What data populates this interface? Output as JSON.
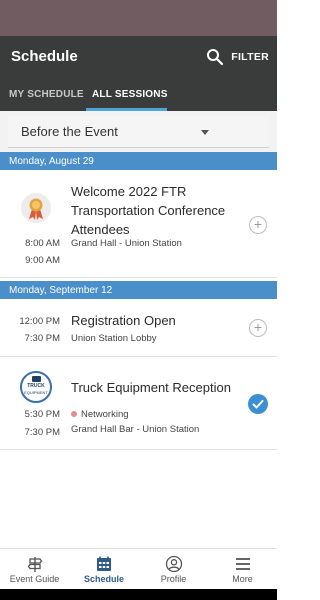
{
  "appbar": {
    "title": "Schedule",
    "filter_label": "FILTER"
  },
  "tabs": [
    {
      "label": "MY SCHEDULE",
      "active": false
    },
    {
      "label": "ALL SESSIONS",
      "active": true
    }
  ],
  "dropdown": {
    "selected": "Before the Event"
  },
  "days": [
    {
      "date": "Monday, August 29"
    },
    {
      "date": "Monday, September 12"
    }
  ],
  "sessions": [
    {
      "title": "Welcome 2022 FTR Transportation Conference Attendees",
      "location": "Grand Hall - Union Station",
      "start": "8:00 AM",
      "end": "9:00 AM",
      "logo": "award-ribbon-icon",
      "added": false
    },
    {
      "title": "Registration Open",
      "location": "Union Station Lobby",
      "start": "12:00 PM",
      "end": "7:30 PM",
      "added": false
    },
    {
      "title": "Truck Equipment Reception",
      "track": "Networking",
      "track_color": "#e98b8b",
      "location": "Grand Hall Bar - Union Station",
      "start": "5:30 PM",
      "end": "7:30 PM",
      "logo": "truck-equipment-logo",
      "logo_text_1": "TRUCK",
      "logo_text_2": "EQUIPMENT",
      "added": true
    }
  ],
  "bottom_nav": [
    {
      "label": "Event Guide",
      "icon": "signpost-icon",
      "active": false
    },
    {
      "label": "Schedule",
      "icon": "calendar-icon",
      "active": true
    },
    {
      "label": "Profile",
      "icon": "profile-icon",
      "active": false
    },
    {
      "label": "More",
      "icon": "menu-icon",
      "active": false
    }
  ],
  "colors": {
    "appbar": "#3a3b3b",
    "accent": "#4ea3d9",
    "date_header": "#4a8fc9",
    "nav_active": "#2e5b8c"
  }
}
